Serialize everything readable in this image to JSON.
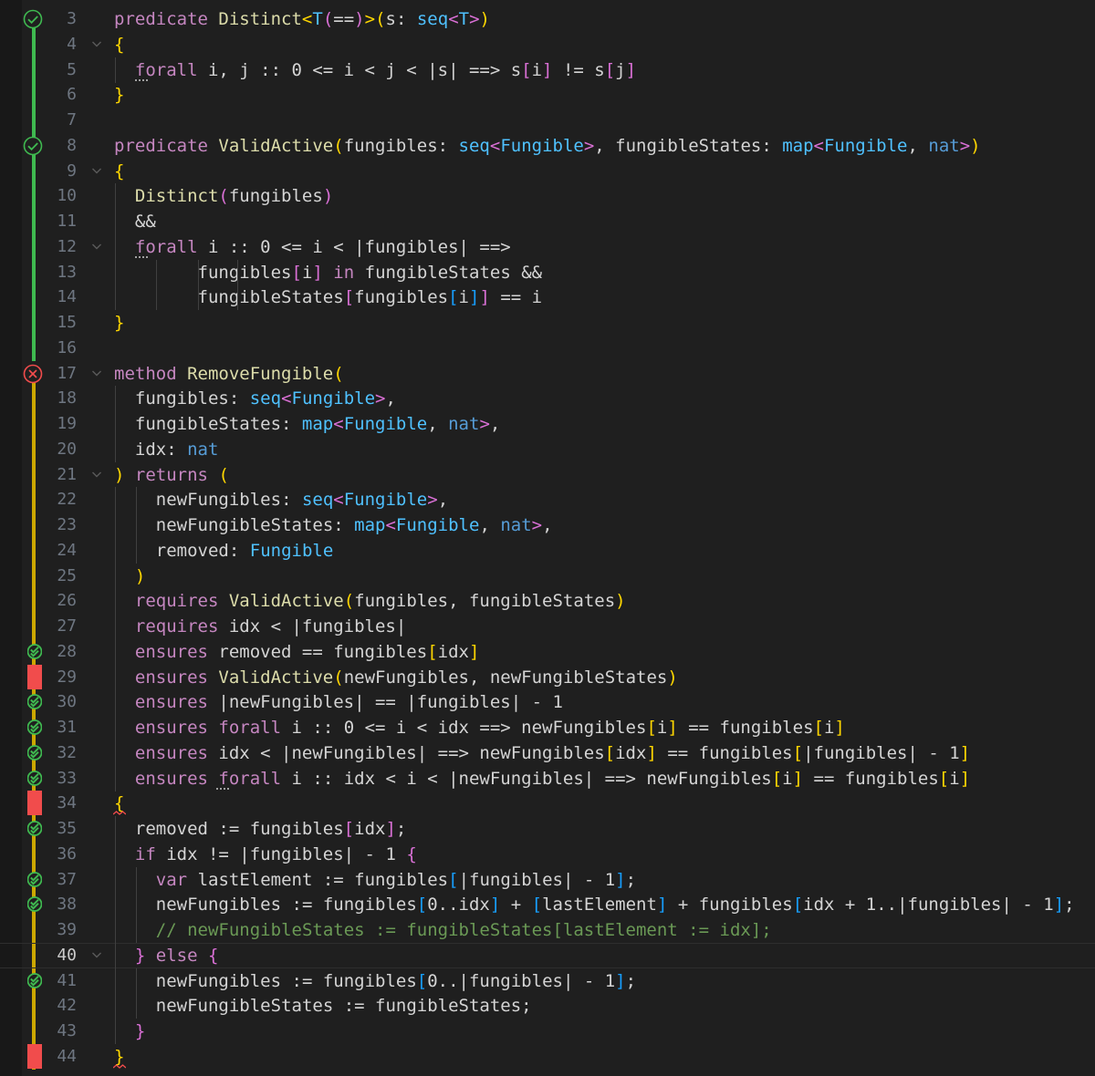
{
  "theme": {
    "background": "#1f1f1f",
    "keyword": "#c586c0",
    "type": "#4fc1ff",
    "function": "#dcdcaa",
    "comment": "#6a9955",
    "bracket_gold": "#ffd700",
    "bracket_purple": "#da70d6",
    "bracket_blue": "#179fff",
    "verified_green": "#3fb950",
    "error_red": "#f14c4c",
    "warning_yellow": "#cca700"
  },
  "editor": {
    "active_line": 40,
    "lines": [
      {
        "n": "3",
        "indent": 0,
        "glyph": "check-circle",
        "fold": false,
        "t": [
          [
            "kw",
            "predicate"
          ],
          [
            "",
            "id",
            " "
          ],
          [
            "fn",
            "Distinct"
          ],
          [
            "b1",
            "<"
          ],
          [
            "typ",
            "T"
          ],
          [
            "b2",
            "("
          ],
          [
            "op",
            "=="
          ],
          [
            "b2",
            ")"
          ],
          [
            "b1",
            ">"
          ],
          [
            "b1",
            "("
          ],
          [
            "id",
            "s: "
          ],
          [
            "typ",
            "seq"
          ],
          [
            "b2",
            "<"
          ],
          [
            "typ",
            "T"
          ],
          [
            "b2",
            ">"
          ],
          [
            "b1",
            ")"
          ]
        ]
      },
      {
        "n": "4",
        "indent": 0,
        "glyph": "",
        "fold": true,
        "t": [
          [
            "b1",
            "{"
          ]
        ]
      },
      {
        "n": "5",
        "indent": 1,
        "glyph": "",
        "fold": false,
        "t": [
          [
            "kw",
            "forall"
          ],
          [
            "id",
            " i, j :: 0 <= i < j < |s| ==> s"
          ],
          [
            "b2",
            "["
          ],
          [
            "id",
            "i"
          ],
          [
            "b2",
            "]"
          ],
          [
            "id",
            " != s"
          ],
          [
            "b2",
            "["
          ],
          [
            "id",
            "j"
          ],
          [
            "b2",
            "]"
          ]
        ]
      },
      {
        "n": "6",
        "indent": 0,
        "glyph": "",
        "fold": false,
        "t": [
          [
            "b1",
            "}"
          ]
        ]
      },
      {
        "n": "7",
        "indent": 0,
        "glyph": "",
        "fold": false,
        "t": []
      },
      {
        "n": "8",
        "indent": 0,
        "glyph": "check-circle",
        "fold": false,
        "t": [
          [
            "kw",
            "predicate"
          ],
          [
            "id",
            " "
          ],
          [
            "fn",
            "ValidActive"
          ],
          [
            "b1",
            "("
          ],
          [
            "id",
            "fungibles: "
          ],
          [
            "typ",
            "seq"
          ],
          [
            "b2",
            "<"
          ],
          [
            "typ",
            "Fungible"
          ],
          [
            "b2",
            ">"
          ],
          [
            "id",
            ", fungibleStates: "
          ],
          [
            "typ",
            "map"
          ],
          [
            "b2",
            "<"
          ],
          [
            "typ",
            "Fungible"
          ],
          [
            "id",
            ", "
          ],
          [
            "tyv",
            "nat"
          ],
          [
            "b2",
            ">"
          ],
          [
            "b1",
            ")"
          ]
        ]
      },
      {
        "n": "9",
        "indent": 0,
        "glyph": "",
        "fold": true,
        "t": [
          [
            "b1",
            "{"
          ]
        ]
      },
      {
        "n": "10",
        "indent": 1,
        "glyph": "",
        "fold": false,
        "t": [
          [
            "fn",
            "Distinct"
          ],
          [
            "b2",
            "("
          ],
          [
            "id",
            "fungibles"
          ],
          [
            "b2",
            ")"
          ]
        ]
      },
      {
        "n": "11",
        "indent": 1,
        "glyph": "",
        "fold": false,
        "t": [
          [
            "id",
            "&&"
          ]
        ]
      },
      {
        "n": "12",
        "indent": 1,
        "glyph": "",
        "fold": true,
        "t": [
          [
            "kw",
            "forall"
          ],
          [
            "id",
            " i :: 0 <= i < |fungibles| ==>"
          ]
        ]
      },
      {
        "n": "13",
        "indent": 1,
        "glyph": "",
        "fold": false,
        "t": [
          [
            "id",
            "      "
          ],
          [
            "id",
            "fungibles"
          ],
          [
            "b2",
            "["
          ],
          [
            "id",
            "i"
          ],
          [
            "b2",
            "]"
          ],
          [
            "id",
            " "
          ],
          [
            "kw",
            "in"
          ],
          [
            "id",
            " fungibleStates &&"
          ]
        ],
        "pad": "      "
      },
      {
        "n": "14",
        "indent": 1,
        "glyph": "",
        "fold": false,
        "t": [
          [
            "id",
            "      "
          ],
          [
            "id",
            "fungibleStates"
          ],
          [
            "b2",
            "["
          ],
          [
            "id",
            "fungibles"
          ],
          [
            "b3",
            "["
          ],
          [
            "id",
            "i"
          ],
          [
            "b3",
            "]"
          ],
          [
            "b2",
            "]"
          ],
          [
            "id",
            " == i"
          ]
        ],
        "pad": "      "
      },
      {
        "n": "15",
        "indent": 0,
        "glyph": "",
        "fold": false,
        "t": [
          [
            "b1",
            "}"
          ]
        ]
      },
      {
        "n": "16",
        "indent": 0,
        "glyph": "",
        "fold": false,
        "t": []
      },
      {
        "n": "17",
        "indent": 0,
        "glyph": "error-circle",
        "fold": true,
        "t": [
          [
            "kw",
            "method"
          ],
          [
            "id",
            " "
          ],
          [
            "fn",
            "RemoveFungible"
          ],
          [
            "b1",
            "("
          ]
        ]
      },
      {
        "n": "18",
        "indent": 1,
        "glyph": "",
        "fold": false,
        "t": [
          [
            "id",
            "fungibles: "
          ],
          [
            "typ",
            "seq"
          ],
          [
            "b2",
            "<"
          ],
          [
            "typ",
            "Fungible"
          ],
          [
            "b2",
            ">"
          ],
          [
            "id",
            ","
          ]
        ]
      },
      {
        "n": "19",
        "indent": 1,
        "glyph": "",
        "fold": false,
        "t": [
          [
            "id",
            "fungibleStates: "
          ],
          [
            "typ",
            "map"
          ],
          [
            "b2",
            "<"
          ],
          [
            "typ",
            "Fungible"
          ],
          [
            "id",
            ", "
          ],
          [
            "tyv",
            "nat"
          ],
          [
            "b2",
            ">"
          ],
          [
            "id",
            ","
          ]
        ]
      },
      {
        "n": "20",
        "indent": 1,
        "glyph": "",
        "fold": false,
        "t": [
          [
            "id",
            "idx: "
          ],
          [
            "tyv",
            "nat"
          ]
        ]
      },
      {
        "n": "21",
        "indent": 0,
        "glyph": "",
        "fold": true,
        "t": [
          [
            "b1",
            ")"
          ],
          [
            "id",
            " "
          ],
          [
            "kw",
            "returns"
          ],
          [
            "id",
            " "
          ],
          [
            "b1",
            "("
          ]
        ]
      },
      {
        "n": "22",
        "indent": 2,
        "glyph": "",
        "fold": false,
        "t": [
          [
            "id",
            "newFungibles: "
          ],
          [
            "typ",
            "seq"
          ],
          [
            "b2",
            "<"
          ],
          [
            "typ",
            "Fungible"
          ],
          [
            "b2",
            ">"
          ],
          [
            "id",
            ","
          ]
        ]
      },
      {
        "n": "23",
        "indent": 2,
        "glyph": "",
        "fold": false,
        "t": [
          [
            "id",
            "newFungibleStates: "
          ],
          [
            "typ",
            "map"
          ],
          [
            "b2",
            "<"
          ],
          [
            "typ",
            "Fungible"
          ],
          [
            "id",
            ", "
          ],
          [
            "tyv",
            "nat"
          ],
          [
            "b2",
            ">"
          ],
          [
            "id",
            ","
          ]
        ]
      },
      {
        "n": "24",
        "indent": 2,
        "glyph": "",
        "fold": false,
        "t": [
          [
            "id",
            "removed: "
          ],
          [
            "typ",
            "Fungible"
          ]
        ]
      },
      {
        "n": "25",
        "indent": 1,
        "glyph": "",
        "fold": false,
        "t": [
          [
            "b1",
            ")"
          ]
        ]
      },
      {
        "n": "26",
        "indent": 1,
        "glyph": "",
        "fold": false,
        "t": [
          [
            "kw",
            "requires"
          ],
          [
            "id",
            " "
          ],
          [
            "fn",
            "ValidActive"
          ],
          [
            "b1",
            "("
          ],
          [
            "id",
            "fungibles, fungibleStates"
          ],
          [
            "b1",
            ")"
          ]
        ]
      },
      {
        "n": "27",
        "indent": 1,
        "glyph": "",
        "fold": false,
        "t": [
          [
            "kw",
            "requires"
          ],
          [
            "id",
            " idx < |fungibles|"
          ]
        ]
      },
      {
        "n": "28",
        "indent": 1,
        "glyph": "",
        "fold": false,
        "t": [
          [
            "kw",
            "ensures"
          ],
          [
            "id",
            " removed == fungibles"
          ],
          [
            "b1",
            "["
          ],
          [
            "id",
            "idx"
          ],
          [
            "b1",
            "]"
          ]
        ]
      },
      {
        "n": "29",
        "indent": 1,
        "glyph": "",
        "fold": false,
        "t": [
          [
            "kw",
            "ensures"
          ],
          [
            "id",
            " "
          ],
          [
            "fn",
            "ValidActive"
          ],
          [
            "b1",
            "("
          ],
          [
            "id",
            "newFungibles, newFungibleStates"
          ],
          [
            "b1",
            ")"
          ]
        ]
      },
      {
        "n": "30",
        "indent": 1,
        "glyph": "",
        "fold": false,
        "t": [
          [
            "kw",
            "ensures"
          ],
          [
            "id",
            " |newFungibles| == |fungibles| - 1"
          ]
        ]
      },
      {
        "n": "31",
        "indent": 1,
        "glyph": "",
        "fold": false,
        "t": [
          [
            "kw",
            "ensures"
          ],
          [
            "id",
            " "
          ],
          [
            "kw",
            "forall"
          ],
          [
            "id",
            " i :: 0 <= i < idx ==> newFungibles"
          ],
          [
            "b1",
            "["
          ],
          [
            "id",
            "i"
          ],
          [
            "b1",
            "]"
          ],
          [
            "id",
            " == fungibles"
          ],
          [
            "b1",
            "["
          ],
          [
            "id",
            "i"
          ],
          [
            "b1",
            "]"
          ]
        ]
      },
      {
        "n": "32",
        "indent": 1,
        "glyph": "",
        "fold": false,
        "t": [
          [
            "kw",
            "ensures"
          ],
          [
            "id",
            " idx < |newFungibles| ==> newFungibles"
          ],
          [
            "b1",
            "["
          ],
          [
            "id",
            "idx"
          ],
          [
            "b1",
            "]"
          ],
          [
            "id",
            " == fungibles"
          ],
          [
            "b1",
            "["
          ],
          [
            "id",
            "|fungibles| - 1"
          ],
          [
            "b1",
            "]"
          ]
        ]
      },
      {
        "n": "33",
        "indent": 1,
        "glyph": "",
        "fold": false,
        "t": [
          [
            "kw",
            "ensures"
          ],
          [
            "id",
            " "
          ],
          [
            "kw",
            "forall"
          ],
          [
            "id",
            " i :: idx < i < |newFungibles| ==> newFungibles"
          ],
          [
            "b1",
            "["
          ],
          [
            "id",
            "i"
          ],
          [
            "b1",
            "]"
          ],
          [
            "id",
            " == fungibles"
          ],
          [
            "b1",
            "["
          ],
          [
            "id",
            "i"
          ],
          [
            "b1",
            "]"
          ]
        ]
      },
      {
        "n": "34",
        "indent": 0,
        "glyph": "",
        "fold": false,
        "t": [
          [
            "b1",
            "{"
          ]
        ]
      },
      {
        "n": "35",
        "indent": 1,
        "glyph": "",
        "fold": false,
        "t": [
          [
            "id",
            "removed := fungibles"
          ],
          [
            "b2",
            "["
          ],
          [
            "id",
            "idx"
          ],
          [
            "b2",
            "]"
          ],
          [
            "id",
            ";"
          ]
        ]
      },
      {
        "n": "36",
        "indent": 1,
        "glyph": "",
        "fold": false,
        "t": [
          [
            "ctl",
            "if"
          ],
          [
            "id",
            " idx != |fungibles| - 1 "
          ],
          [
            "b2",
            "{"
          ]
        ]
      },
      {
        "n": "37",
        "indent": 2,
        "glyph": "",
        "fold": false,
        "t": [
          [
            "kw",
            "var"
          ],
          [
            "id",
            " lastElement := fungibles"
          ],
          [
            "b3",
            "["
          ],
          [
            "id",
            "|fungibles| - 1"
          ],
          [
            "b3",
            "]"
          ],
          [
            "id",
            ";"
          ]
        ]
      },
      {
        "n": "38",
        "indent": 2,
        "glyph": "",
        "fold": false,
        "t": [
          [
            "id",
            "newFungibles := fungibles"
          ],
          [
            "b3",
            "["
          ],
          [
            "id",
            "0..idx"
          ],
          [
            "b3",
            "]"
          ],
          [
            "id",
            " + "
          ],
          [
            "b3",
            "["
          ],
          [
            "id",
            "lastElement"
          ],
          [
            "b3",
            "]"
          ],
          [
            "id",
            " + fungibles"
          ],
          [
            "b3",
            "["
          ],
          [
            "id",
            "idx + 1..|fungibles| - 1"
          ],
          [
            "b3",
            "]"
          ],
          [
            "id",
            ";"
          ]
        ]
      },
      {
        "n": "39",
        "indent": 2,
        "glyph": "",
        "fold": false,
        "t": [
          [
            "cmt",
            "// newFungibleStates := fungibleStates[lastElement := idx];"
          ]
        ]
      },
      {
        "n": "40",
        "indent": 1,
        "glyph": "",
        "fold": true,
        "t": [
          [
            "b2",
            "}"
          ],
          [
            "id",
            " "
          ],
          [
            "ctl",
            "else"
          ],
          [
            "id",
            " "
          ],
          [
            "b2",
            "{"
          ]
        ]
      },
      {
        "n": "41",
        "indent": 2,
        "glyph": "",
        "fold": false,
        "t": [
          [
            "id",
            "newFungibles := fungibles"
          ],
          [
            "b3",
            "["
          ],
          [
            "id",
            "0..|fungibles| - 1"
          ],
          [
            "b3",
            "]"
          ],
          [
            "id",
            ";"
          ]
        ]
      },
      {
        "n": "42",
        "indent": 2,
        "glyph": "",
        "fold": false,
        "t": [
          [
            "id",
            "newFungibleStates := fungibleStates;"
          ]
        ]
      },
      {
        "n": "43",
        "indent": 1,
        "glyph": "",
        "fold": false,
        "t": [
          [
            "b2",
            "}"
          ]
        ]
      },
      {
        "n": "44",
        "indent": 0,
        "glyph": "",
        "fold": false,
        "t": [
          [
            "b1",
            "}"
          ]
        ]
      }
    ],
    "gutter_marks": {
      "verified": [
        "28",
        "30",
        "31",
        "32",
        "33",
        "35",
        "37",
        "38",
        "41"
      ],
      "failed": [
        "29",
        "34",
        "44"
      ]
    }
  }
}
